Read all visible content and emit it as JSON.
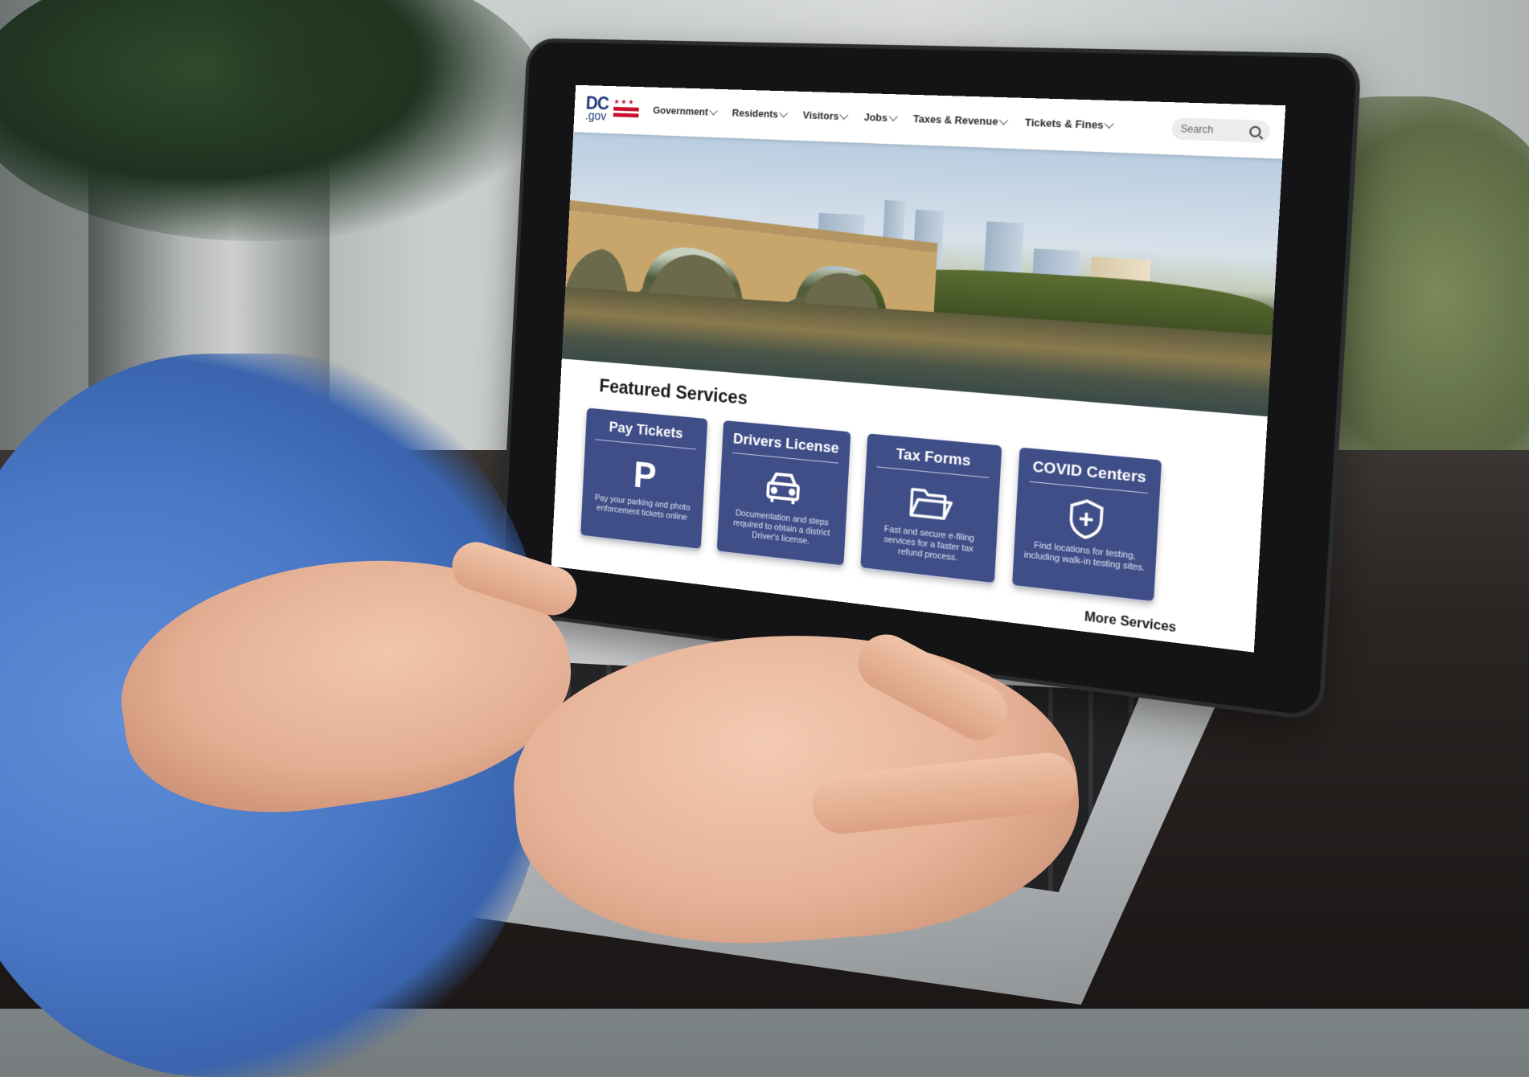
{
  "site": {
    "logo": {
      "dc": "DC",
      "gov": ".gov",
      "stars": "★★★"
    }
  },
  "nav": {
    "items": [
      {
        "label": "Government"
      },
      {
        "label": "Residents"
      },
      {
        "label": "Visitors"
      },
      {
        "label": "Jobs"
      },
      {
        "label": "Taxes & Revenue"
      },
      {
        "label": "Tickets & Fines"
      }
    ],
    "search": {
      "placeholder": "Search"
    }
  },
  "main": {
    "section_title": "Featured Services",
    "cards": [
      {
        "title": "Pay Tickets",
        "icon": "parking-p-icon",
        "description": "Pay your parking and photo enforcement tickets online"
      },
      {
        "title": "Drivers License",
        "icon": "car-icon",
        "description": "Documentation and steps required to obtain a district Driver's license."
      },
      {
        "title": "Tax Forms",
        "icon": "folder-icon",
        "description": "Fast and secure e-filing services for a faster tax refund process."
      },
      {
        "title": "COVID Centers",
        "icon": "shield-plus-icon",
        "description": "Find locations for testing, including walk-in testing sites."
      }
    ],
    "more_link": "More Services"
  },
  "colors": {
    "card_bg": "#3f4e87",
    "brand_blue": "#1d3b7a",
    "brand_red": "#c8102e"
  }
}
